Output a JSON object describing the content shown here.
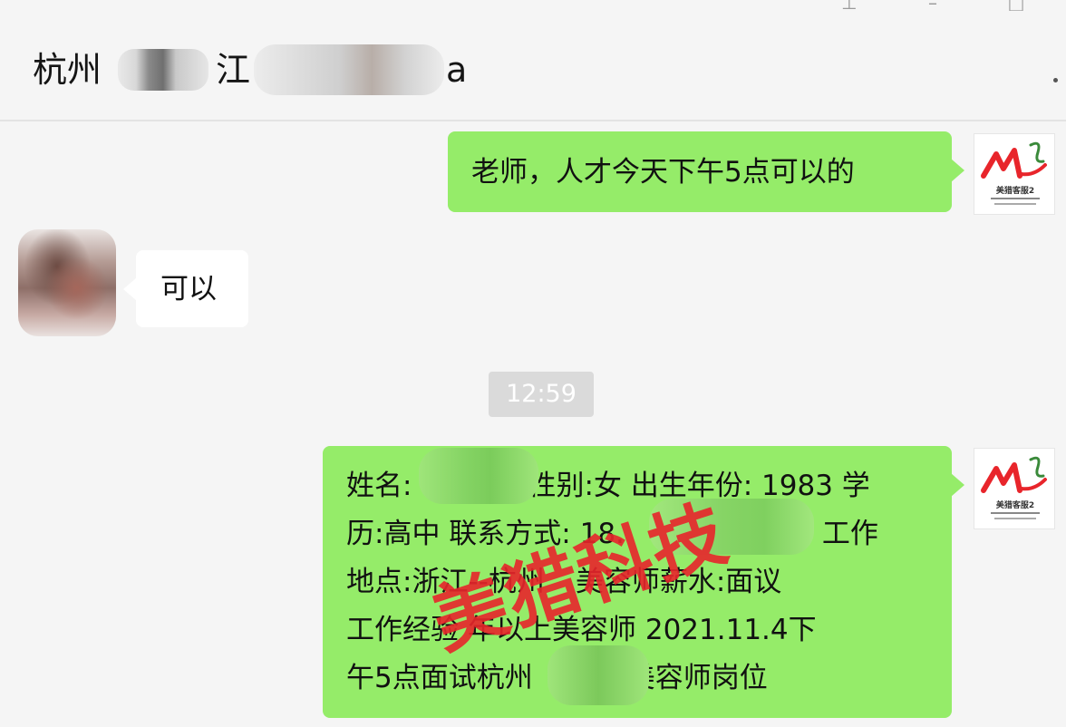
{
  "window": {
    "title_prefix": "杭州",
    "title_mid": "江",
    "title_suffix": "a",
    "controls": {
      "pin": "⊥",
      "minimize": "–",
      "maximize": "□"
    }
  },
  "messages": [
    {
      "from": "me",
      "text": "老师，人才今天下午5点可以的"
    },
    {
      "from": "them",
      "text": "可以"
    },
    {
      "type": "timestamp",
      "text": "12:59"
    },
    {
      "from": "me",
      "lines": [
        "姓名:",
        "性别:女 出生年份: 1983 学",
        "历:高中 联系方式: 18.",
        ") 工作",
        "地点:浙江--杭州",
        "美容师",
        "薪水:面议",
        "工作经验",
        "年以上美容师 2021.11.4下",
        "午5点面试杭州",
        "美容师岗位"
      ]
    }
  ],
  "avatar_logo": {
    "caption": "美猎客服2"
  },
  "watermark": {
    "text": "美猎科技",
    "color": "#e8252b"
  },
  "colors": {
    "me_bubble": "#95ec69",
    "them_bubble": "#ffffff",
    "background": "#f5f5f5"
  }
}
